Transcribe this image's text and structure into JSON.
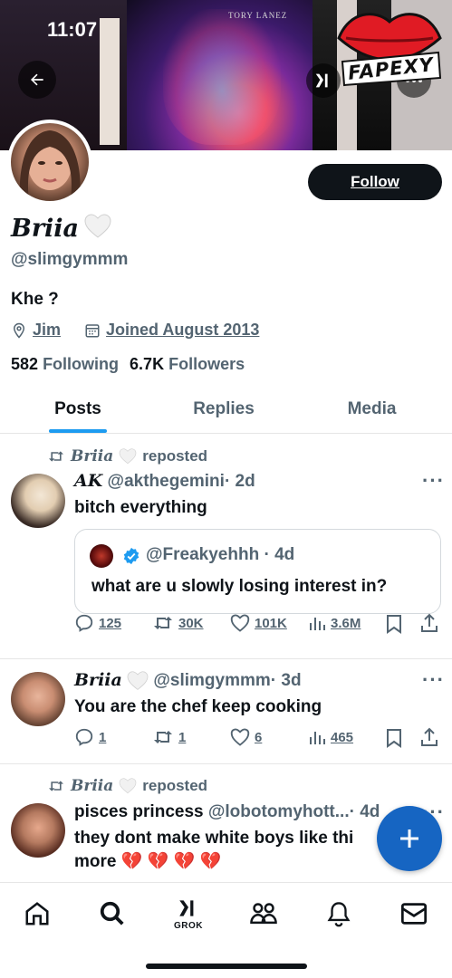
{
  "status_bar": {
    "time": "11:07"
  },
  "banner": {
    "album_text": "TORY LANEZ",
    "watermark_text": "FAPEXY"
  },
  "profile": {
    "display_name": "Briia",
    "handle": "@slimgymmm",
    "bio": "Khe ?",
    "location": "Jim",
    "joined": "Joined August 2013",
    "following_count": "582",
    "following_label": "Following",
    "followers_count": "6.7K",
    "followers_label": "Followers",
    "follow_label": "Follow"
  },
  "tabs": [
    {
      "label": "Posts",
      "active": true
    },
    {
      "label": "Replies",
      "active": false
    },
    {
      "label": "Media",
      "active": false
    }
  ],
  "posts": [
    {
      "repost_by": "Briia",
      "repost_label": "reposted",
      "author_name": "AK",
      "author_handle": "@akthegemini",
      "time": "· 2d",
      "text": "bitch everything",
      "quote": {
        "handle": "@Freakyehhh",
        "time": "· 4d",
        "text": "what are u slowly losing interest in?"
      },
      "replies": "125",
      "reposts": "30K",
      "likes": "101K",
      "views": "3.6M"
    },
    {
      "author_name": "Briia",
      "author_handle": "@slimgymmm",
      "time": "· 3d",
      "text": "You are the chef keep cooking",
      "replies": "1",
      "reposts": "1",
      "likes": "6",
      "views": "465"
    },
    {
      "repost_by": "Briia",
      "repost_label": "reposted",
      "author_name": "pisces princess",
      "author_handle": "@lobotomyhott...",
      "time": "· 4d",
      "text_line1": "they dont make white boys like thi",
      "text_line2": "more 💔 💔 💔 💔"
    }
  ],
  "bottom_nav": {
    "grok_label": "GROK"
  },
  "colors": {
    "accent": "#1d9bf0",
    "fab": "#1665c2",
    "text": "#0f1419",
    "muted": "#536471"
  }
}
